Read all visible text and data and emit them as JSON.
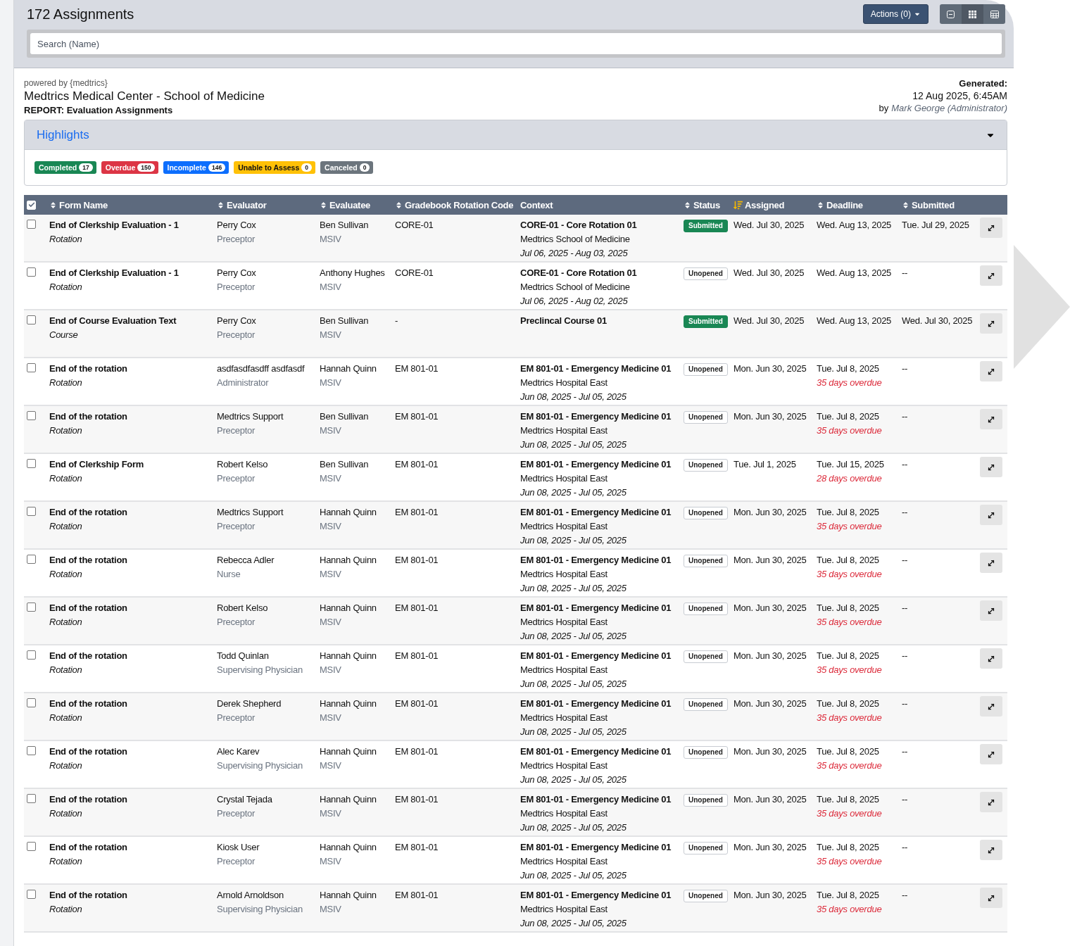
{
  "header": {
    "title": "172 Assignments",
    "actions_button": "Actions (0)",
    "view_buttons": [
      {
        "kind": "compact",
        "selected": false
      },
      {
        "kind": "grid",
        "selected": true
      },
      {
        "kind": "table",
        "selected": false
      }
    ],
    "search": {
      "placeholder": "Search (Name)"
    }
  },
  "report": {
    "powered_by": "powered by {medtrics}",
    "institution": "Medtrics Medical Center - School of Medicine",
    "report_title": "REPORT: Evaluation Assignments",
    "generated_label": "Generated:",
    "generated_at": "12 Aug 2025, 6:45AM",
    "by_label": "by",
    "by_user": "Mark George (Administrator)"
  },
  "highlights": {
    "title": "Highlights",
    "expanded": true,
    "badges": [
      {
        "label": "Completed",
        "count": "17",
        "color": "#198754"
      },
      {
        "label": "Overdue",
        "count": "150",
        "color": "#dc3545"
      },
      {
        "label": "Incomplete",
        "count": "146",
        "color": "#0d6efd"
      },
      {
        "label": "Unable to Assess",
        "count": "0",
        "color": "#ffc107"
      },
      {
        "label": "Canceled",
        "count": "0",
        "color": "#6c757d"
      }
    ]
  },
  "table": {
    "select_all_checked": true,
    "columns": [
      {
        "label": "Form Name",
        "kind": "sortable",
        "sorted": false
      },
      {
        "label": "Evaluator",
        "kind": "sortable",
        "sorted": false
      },
      {
        "label": "Evaluatee",
        "kind": "sortable",
        "sorted": false
      },
      {
        "label": "Gradebook Rotation Code",
        "kind": "sortable",
        "sorted": false
      },
      {
        "label": "Context",
        "kind": "plain"
      },
      {
        "label": "Status",
        "kind": "sortable",
        "sorted": false
      },
      {
        "label": "Assigned",
        "kind": "sortable",
        "sorted": true
      },
      {
        "label": "Deadline",
        "kind": "sortable",
        "sorted": false
      },
      {
        "label": "Submitted",
        "kind": "sortable",
        "sorted": false
      }
    ],
    "rows": [
      {
        "checked": false,
        "form": "End of Clerkship Evaluation - 1",
        "form_type": "Rotation",
        "evaluator": "Perry Cox",
        "evaluator_role": "Preceptor",
        "evaluatee": "Ben Sullivan",
        "evaluatee_role": "MSIV",
        "code": "CORE-01",
        "context_title": "CORE-01 - Core Rotation 01",
        "context_place": "Medtrics School of Medicine",
        "context_dates": "Jul 06, 2025 - Aug 03, 2025",
        "status": "Submitted",
        "submitted_state": true,
        "assigned": "Wed. Jul 30, 2025",
        "deadline": "Wed. Aug 13, 2025",
        "submitted": "Tue. Jul 29, 2025"
      },
      {
        "checked": false,
        "form": "End of Clerkship Evaluation - 1",
        "form_type": "Rotation",
        "evaluator": "Perry Cox",
        "evaluator_role": "Preceptor",
        "evaluatee": "Anthony Hughes",
        "evaluatee_role": "MSIV",
        "code": "CORE-01",
        "context_title": "CORE-01 - Core Rotation 01",
        "context_place": "Medtrics School of Medicine",
        "context_dates": "Jul 06, 2025 - Aug 02, 2025",
        "status": "Unopened",
        "submitted_state": false,
        "assigned": "Wed. Jul 30, 2025",
        "deadline": "Wed. Aug 13, 2025",
        "submitted": "--"
      },
      {
        "checked": false,
        "form": "End of Course Evaluation Text",
        "form_type": "Course",
        "evaluator": "Perry Cox",
        "evaluator_role": "Preceptor",
        "evaluatee": "Ben Sullivan",
        "evaluatee_role": "MSIV",
        "code": "-",
        "context_title": "Preclincal Course 01",
        "status": "Submitted",
        "submitted_state": true,
        "assigned": "Wed. Jul 30, 2025",
        "deadline": "Wed. Aug 13, 2025",
        "submitted": "Wed. Jul 30, 2025"
      },
      {
        "checked": false,
        "form": "End of the rotation",
        "form_type": "Rotation",
        "evaluator": "asdfasdfasdff asdfasdf",
        "evaluator_role": "Administrator",
        "evaluatee": "Hannah Quinn",
        "evaluatee_role": "MSIV",
        "code": "EM 801-01",
        "context_title": "EM 801-01 - Emergency Medicine 01",
        "context_place": "Medtrics Hospital East",
        "context_dates": "Jun 08, 2025 - Jul 05, 2025",
        "status": "Unopened",
        "submitted_state": false,
        "assigned": "Mon. Jun 30, 2025",
        "deadline": "Tue. Jul 8, 2025",
        "overdue": "35 days overdue",
        "submitted": "--"
      },
      {
        "checked": false,
        "form": "End of the rotation",
        "form_type": "Rotation",
        "evaluator": "Medtrics Support",
        "evaluator_role": "Preceptor",
        "evaluatee": "Ben Sullivan",
        "evaluatee_role": "MSIV",
        "code": "EM 801-01",
        "context_title": "EM 801-01 - Emergency Medicine 01",
        "context_place": "Medtrics Hospital East",
        "context_dates": "Jun 08, 2025 - Jul 05, 2025",
        "status": "Unopened",
        "submitted_state": false,
        "assigned": "Mon. Jun 30, 2025",
        "deadline": "Tue. Jul 8, 2025",
        "overdue": "35 days overdue",
        "submitted": "--"
      },
      {
        "checked": false,
        "form": "End of Clerkship Form",
        "form_type": "Rotation",
        "evaluator": "Robert Kelso",
        "evaluator_role": "Preceptor",
        "evaluatee": "Ben Sullivan",
        "evaluatee_role": "MSIV",
        "code": "EM 801-01",
        "context_title": "EM 801-01 - Emergency Medicine 01",
        "context_place": "Medtrics Hospital East",
        "context_dates": "Jun 08, 2025 - Jul 05, 2025",
        "status": "Unopened",
        "submitted_state": false,
        "assigned": "Tue. Jul 1, 2025",
        "deadline": "Tue. Jul 15, 2025",
        "overdue": "28 days overdue",
        "submitted": "--"
      },
      {
        "checked": false,
        "form": "End of the rotation",
        "form_type": "Rotation",
        "evaluator": "Medtrics Support",
        "evaluator_role": "Preceptor",
        "evaluatee": "Hannah Quinn",
        "evaluatee_role": "MSIV",
        "code": "EM 801-01",
        "context_title": "EM 801-01 - Emergency Medicine 01",
        "context_place": "Medtrics Hospital East",
        "context_dates": "Jun 08, 2025 - Jul 05, 2025",
        "status": "Unopened",
        "submitted_state": false,
        "assigned": "Mon. Jun 30, 2025",
        "deadline": "Tue. Jul 8, 2025",
        "overdue": "35 days overdue",
        "submitted": "--"
      },
      {
        "checked": false,
        "form": "End of the rotation",
        "form_type": "Rotation",
        "evaluator": "Rebecca Adler",
        "evaluator_role": "Nurse",
        "evaluatee": "Hannah Quinn",
        "evaluatee_role": "MSIV",
        "code": "EM 801-01",
        "context_title": "EM 801-01 - Emergency Medicine 01",
        "context_place": "Medtrics Hospital East",
        "context_dates": "Jun 08, 2025 - Jul 05, 2025",
        "status": "Unopened",
        "submitted_state": false,
        "assigned": "Mon. Jun 30, 2025",
        "deadline": "Tue. Jul 8, 2025",
        "overdue": "35 days overdue",
        "submitted": "--"
      },
      {
        "checked": false,
        "form": "End of the rotation",
        "form_type": "Rotation",
        "evaluator": "Robert Kelso",
        "evaluator_role": "Preceptor",
        "evaluatee": "Hannah Quinn",
        "evaluatee_role": "MSIV",
        "code": "EM 801-01",
        "context_title": "EM 801-01 - Emergency Medicine 01",
        "context_place": "Medtrics Hospital East",
        "context_dates": "Jun 08, 2025 - Jul 05, 2025",
        "status": "Unopened",
        "submitted_state": false,
        "assigned": "Mon. Jun 30, 2025",
        "deadline": "Tue. Jul 8, 2025",
        "overdue": "35 days overdue",
        "submitted": "--"
      },
      {
        "checked": false,
        "form": "End of the rotation",
        "form_type": "Rotation",
        "evaluator": "Todd Quinlan",
        "evaluator_role": "Supervising Physician",
        "evaluatee": "Hannah Quinn",
        "evaluatee_role": "MSIV",
        "code": "EM 801-01",
        "context_title": "EM 801-01 - Emergency Medicine 01",
        "context_place": "Medtrics Hospital East",
        "context_dates": "Jun 08, 2025 - Jul 05, 2025",
        "status": "Unopened",
        "submitted_state": false,
        "assigned": "Mon. Jun 30, 2025",
        "deadline": "Tue. Jul 8, 2025",
        "overdue": "35 days overdue",
        "submitted": "--"
      },
      {
        "checked": false,
        "form": "End of the rotation",
        "form_type": "Rotation",
        "evaluator": "Derek Shepherd",
        "evaluator_role": "Preceptor",
        "evaluatee": "Hannah Quinn",
        "evaluatee_role": "MSIV",
        "code": "EM 801-01",
        "context_title": "EM 801-01 - Emergency Medicine 01",
        "context_place": "Medtrics Hospital East",
        "context_dates": "Jun 08, 2025 - Jul 05, 2025",
        "status": "Unopened",
        "submitted_state": false,
        "assigned": "Mon. Jun 30, 2025",
        "deadline": "Tue. Jul 8, 2025",
        "overdue": "35 days overdue",
        "submitted": "--"
      },
      {
        "checked": false,
        "form": "End of the rotation",
        "form_type": "Rotation",
        "evaluator": "Alec Karev",
        "evaluator_role": "Supervising Physician",
        "evaluatee": "Hannah Quinn",
        "evaluatee_role": "MSIV",
        "code": "EM 801-01",
        "context_title": "EM 801-01 - Emergency Medicine 01",
        "context_place": "Medtrics Hospital East",
        "context_dates": "Jun 08, 2025 - Jul 05, 2025",
        "status": "Unopened",
        "submitted_state": false,
        "assigned": "Mon. Jun 30, 2025",
        "deadline": "Tue. Jul 8, 2025",
        "overdue": "35 days overdue",
        "submitted": "--"
      },
      {
        "checked": false,
        "form": "End of the rotation",
        "form_type": "Rotation",
        "evaluator": "Crystal Tejada",
        "evaluator_role": "Preceptor",
        "evaluatee": "Hannah Quinn",
        "evaluatee_role": "MSIV",
        "code": "EM 801-01",
        "context_title": "EM 801-01 - Emergency Medicine 01",
        "context_place": "Medtrics Hospital East",
        "context_dates": "Jun 08, 2025 - Jul 05, 2025",
        "status": "Unopened",
        "submitted_state": false,
        "assigned": "Mon. Jun 30, 2025",
        "deadline": "Tue. Jul 8, 2025",
        "overdue": "35 days overdue",
        "submitted": "--"
      },
      {
        "checked": false,
        "form": "End of the rotation",
        "form_type": "Rotation",
        "evaluator": "Kiosk User",
        "evaluator_role": "Preceptor",
        "evaluatee": "Hannah Quinn",
        "evaluatee_role": "MSIV",
        "code": "EM 801-01",
        "context_title": "EM 801-01 - Emergency Medicine 01",
        "context_place": "Medtrics Hospital East",
        "context_dates": "Jun 08, 2025 - Jul 05, 2025",
        "status": "Unopened",
        "submitted_state": false,
        "assigned": "Mon. Jun 30, 2025",
        "deadline": "Tue. Jul 8, 2025",
        "overdue": "35 days overdue",
        "submitted": "--"
      },
      {
        "checked": false,
        "form": "End of the rotation",
        "form_type": "Rotation",
        "evaluator": "Arnold Arnoldson",
        "evaluator_role": "Supervising Physician",
        "evaluatee": "Hannah Quinn",
        "evaluatee_role": "MSIV",
        "code": "EM 801-01",
        "context_title": "EM 801-01 - Emergency Medicine 01",
        "context_place": "Medtrics Hospital East",
        "context_dates": "Jun 08, 2025 - Jul 05, 2025",
        "status": "Unopened",
        "submitted_state": false,
        "assigned": "Mon. Jun 30, 2025",
        "deadline": "Tue. Jul 8, 2025",
        "overdue": "35 days overdue",
        "submitted": "--"
      }
    ]
  }
}
